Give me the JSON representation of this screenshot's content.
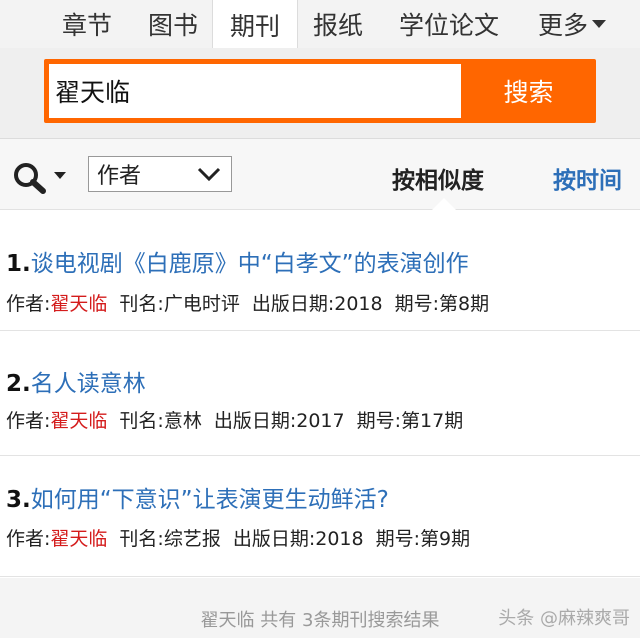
{
  "tabs": {
    "items": [
      {
        "label": "章节"
      },
      {
        "label": "图书"
      },
      {
        "label": "期刊"
      },
      {
        "label": "报纸"
      },
      {
        "label": "学位论文"
      },
      {
        "label": "更多"
      }
    ],
    "active": "期刊"
  },
  "search": {
    "query": "翟天临",
    "button_label": "搜索"
  },
  "filter": {
    "field_selected": "作者",
    "sort_relevance_label": "按相似度",
    "sort_time_label": "按时间"
  },
  "labels": {
    "author": "作者:",
    "journal": "刊名:",
    "date": "出版日期:",
    "issue": "期号:"
  },
  "results": [
    {
      "num": "1.",
      "title": "谈电视剧《白鹿原》中“白孝文”的表演创作",
      "author": "翟天临",
      "journal": "广电时评",
      "date": "2018",
      "issue": "第8期"
    },
    {
      "num": "2.",
      "title": "名人读意林",
      "author": "翟天临",
      "journal": "意林",
      "date": "2017",
      "issue": "第17期"
    },
    {
      "num": "3.",
      "title": "如何用“下意识”让表演更生动鲜活?",
      "author": "翟天临",
      "journal": "综艺报",
      "date": "2018",
      "issue": "第9期"
    }
  ],
  "footer": {
    "summary": "翟天临  共有 3条期刊搜索结果",
    "watermark": "头条 @麻辣爽哥"
  },
  "colors": {
    "accent": "#ff6600",
    "link": "#2d6fb8",
    "highlight": "#d41c1c"
  }
}
